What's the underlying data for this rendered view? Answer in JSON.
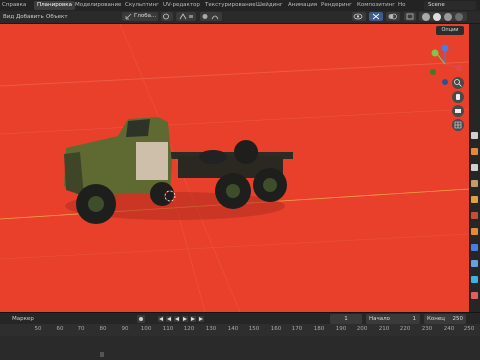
{
  "topbar": {
    "tabs": [
      {
        "label": "Справка",
        "active": false
      },
      {
        "label": "Планировка",
        "active": true
      },
      {
        "label": "Моделирование",
        "active": false
      },
      {
        "label": "Скульптинг",
        "active": false
      },
      {
        "label": "UV-редактор",
        "active": false
      },
      {
        "label": "Текстурирование",
        "active": false
      },
      {
        "label": "Шейдинг",
        "active": false
      },
      {
        "label": "Анимация",
        "active": false
      },
      {
        "label": "Рендеринг",
        "active": false
      },
      {
        "label": "Композитинг",
        "active": false
      },
      {
        "label": "Но",
        "active": false
      }
    ],
    "scene_label": "Scene"
  },
  "header": {
    "menu_view": "Вид",
    "menu_add": "Добавить",
    "menu_object": "Объект",
    "transform_orientation": "Глоба..."
  },
  "viewport": {
    "options_label": "Опции",
    "background_color": "#e8402b"
  },
  "timeline": {
    "marker_label": "Маркер",
    "current_frame": "1",
    "start_label": "Начало",
    "start_value": "1",
    "end_label": "Конец",
    "end_value": "250",
    "ruler_ticks": [
      "50",
      "60",
      "70",
      "80",
      "90",
      "100",
      "110",
      "120",
      "130",
      "140",
      "150",
      "160",
      "170",
      "180",
      "190",
      "200",
      "210",
      "220",
      "230",
      "240",
      "250"
    ]
  },
  "colors": {
    "truck_cab": "#5f6a33",
    "truck_chassis": "#2c2b24",
    "gizmo_x": "#e04848",
    "gizmo_y": "#7ec74b",
    "gizmo_z": "#4b7de0"
  }
}
